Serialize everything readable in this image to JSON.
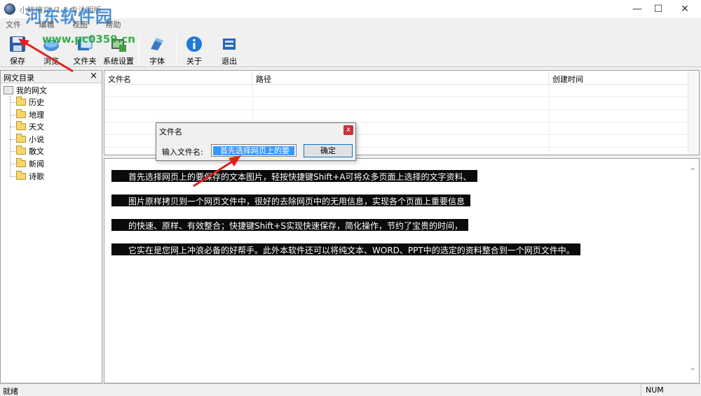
{
  "window": {
    "title": "小眸摘文V1.3 专注明版",
    "watermark": "河东软件园",
    "watermark_url": "www.pc0359.cn",
    "minimize_label": "—",
    "maximize_label": "☐",
    "close_label": "✕"
  },
  "menu": [
    "文件",
    "编辑",
    "视图",
    "帮助"
  ],
  "toolbar": {
    "buttons": [
      {
        "label": "保存",
        "icon": "floppy-disk-icon"
      },
      {
        "label": "浏览",
        "icon": "browse-globe-icon"
      },
      {
        "label": "文件夹",
        "icon": "folder-icon"
      },
      {
        "label": "系统设置",
        "icon": "settings-icon"
      },
      {
        "label": "字体",
        "icon": "font-icon"
      },
      {
        "label": "关于",
        "icon": "info-icon"
      },
      {
        "label": "退出",
        "icon": "exit-icon"
      }
    ]
  },
  "tree": {
    "header": "网文目录",
    "close_label": "×",
    "root": "我的网文",
    "items": [
      "历史",
      "地理",
      "天文",
      "小说",
      "散文",
      "新闻",
      "诗歌"
    ]
  },
  "filelist": {
    "columns": [
      "文件名",
      "路径",
      "创建时间"
    ]
  },
  "content": {
    "lines": [
      "首先选择网页上的要保存的文本图片，轻按快捷键Shift+A可将众多页面上选择的文字资料、",
      "图片原样拷贝到一个网页文件中，很好的去除网页中的无用信息，实现各个页面上重要信息",
      "的快速、原样、有效整合；快捷键Shift+S实现快速保存，简化操作，节约了宝贵的时间，",
      "它实在是您网上冲浪必备的好帮手。此外本软件还可以将纯文本、WORD、PPT中的选定的资料整合到一个网页文件中。"
    ]
  },
  "dialog": {
    "title": "文件名",
    "close_label": "x",
    "input_label": "输入文件名:",
    "input_value": "首先选择网页上的要",
    "ok_label": "确定"
  },
  "statusbar": {
    "left": "就绪",
    "num": "NUM"
  },
  "colors": {
    "annotation_arrow": "#e02020",
    "selection": "#3399ff",
    "highlight_bg": "#0a0a0a"
  }
}
